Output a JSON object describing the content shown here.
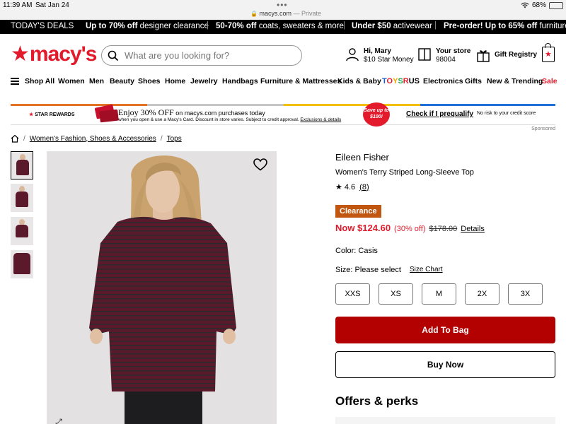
{
  "status_bar": {
    "time": "11:39 AM",
    "date": "Sat Jan 24",
    "url_domain": "macys.com",
    "url_suffix": "— Private",
    "battery": "68%",
    "battery_level": 0.68
  },
  "deals_bar": {
    "label": "TODAY'S DEALS",
    "items": [
      {
        "bold": "Up to 70% off",
        "rest": " designer clearance"
      },
      {
        "bold": "50-70% off",
        "rest": " coats, sweaters & more"
      },
      {
        "bold": "Under $50",
        "rest": " activewear"
      },
      {
        "bold": "Pre-order! Up to 65% off",
        "rest": " furniture &"
      }
    ]
  },
  "header": {
    "logo": "macy's",
    "search_placeholder": "What are you looking for?",
    "account": {
      "line1": "Hi, Mary",
      "line2": "$10 Star Money"
    },
    "store": {
      "line1": "Your store",
      "line2": "98004"
    },
    "registry": "Gift Registry"
  },
  "nav": {
    "items": [
      "Shop All",
      "Women",
      "Men",
      "Beauty",
      "Shoes",
      "Home",
      "Jewelry",
      "Handbags",
      "Furniture & Mattresses",
      "Kids & Baby",
      "Electronics",
      "Gifts",
      "New & Trending"
    ],
    "toys": [
      "T",
      "O",
      "Y",
      "S",
      "R",
      "US"
    ],
    "sale": "Sale"
  },
  "promo": {
    "rewards_star": "★",
    "rewards_label": "STAR REWARDS",
    "headline": "Enjoy 30% OFF",
    "headline_tail": " on macys.com purchases today",
    "fine": "when you open & use a Macy's Card. Discount in store varies. Subject to credit approval.",
    "fine_link": "Exclusions & details",
    "save_badge": "Save up to $100!",
    "cta": "Check if I prequalify",
    "cta_note": "No risk to your credit score",
    "sponsored": "Sponsored",
    "stripe_colors": [
      "#e37222",
      "#c6c6c6",
      "#f2c000",
      "#1e6fd9"
    ]
  },
  "breadcrumb": [
    "Women's Fashion, Shoes & Accessories",
    "Tops"
  ],
  "product": {
    "brand": "Eileen Fisher",
    "name": "Women's Terry Striped Long-Sleeve Top",
    "rating": "4.6",
    "review_count": "(8)",
    "badge": "Clearance",
    "price_now": "Now $124.60",
    "discount": "(30% off)",
    "price_orig": "$178.00",
    "details": "Details",
    "color_label": "Color: Casis",
    "size_label": "Size: Please select",
    "size_chart": "Size Chart",
    "sizes": [
      "XXS",
      "XS",
      "M",
      "2X",
      "3X"
    ],
    "add_to_bag": "Add To Bag",
    "buy_now": "Buy Now",
    "offers_heading": "Offers & perks",
    "colors": {
      "shirt": "#5a1a2c",
      "stripe": "#2b2a2e",
      "accent": "#e21a2c",
      "button": "#b30000",
      "badge": "#c0560f"
    }
  }
}
